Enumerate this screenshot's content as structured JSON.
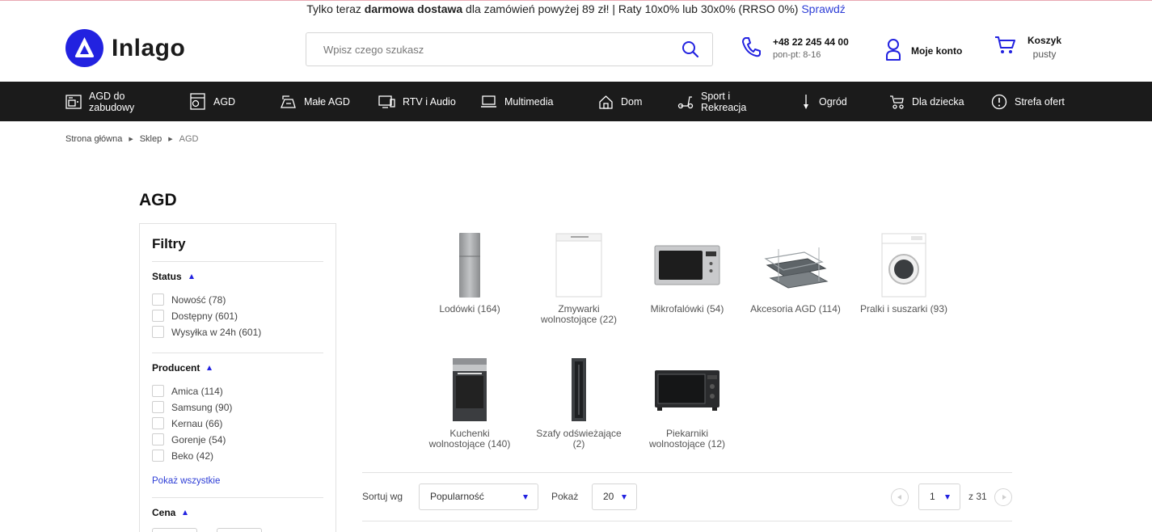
{
  "promo": {
    "before": "Tylko teraz ",
    "bold": "darmowa dostawa",
    "after": " dla zamówień powyżej 89 zł! | Raty 10x0% lub 30x0% (RRSO 0%) ",
    "link": "Sprawdź"
  },
  "brand": {
    "name": "Inlago",
    "color": "#2222e0"
  },
  "search": {
    "placeholder": "Wpisz czego szukasz"
  },
  "contact": {
    "phone": "+48 22 245 44 00",
    "hours": "pon-pt: 8-16"
  },
  "account": {
    "label": "Moje konto"
  },
  "cart": {
    "title": "Koszyk",
    "status": "pusty"
  },
  "nav": [
    {
      "label": "AGD do zabudowy",
      "icon": "built-in-appliance-icon"
    },
    {
      "label": "AGD",
      "icon": "fridge-icon"
    },
    {
      "label": "Małe AGD",
      "icon": "small-appliance-icon"
    },
    {
      "label": "RTV i Audio",
      "icon": "tv-icon"
    },
    {
      "label": "Multimedia",
      "icon": "laptop-icon"
    },
    {
      "label": "Dom",
      "icon": "home-icon"
    },
    {
      "label": "Sport i Rekreacja",
      "icon": "scooter-icon"
    },
    {
      "label": "Ogród",
      "icon": "garden-tool-icon"
    },
    {
      "label": "Dla dziecka",
      "icon": "stroller-icon"
    },
    {
      "label": "Strefa ofert",
      "icon": "offer-alert-icon"
    }
  ],
  "breadcrumb": {
    "home": "Strona główna",
    "shop": "Sklep",
    "current": "AGD"
  },
  "page_title": "AGD",
  "filters": {
    "title": "Filtry",
    "status": {
      "heading": "Status",
      "options": [
        "Nowość (78)",
        "Dostępny (601)",
        "Wysyłka w 24h (601)"
      ]
    },
    "producer": {
      "heading": "Producent",
      "options": [
        "Amica (114)",
        "Samsung (90)",
        "Kernau (66)",
        "Gorenje (54)",
        "Beko (42)"
      ],
      "show_all": "Pokaż wszystkie"
    },
    "price": {
      "heading": "Cena"
    }
  },
  "categories": [
    {
      "name": "Lodówki (164)",
      "icon": "fridge-image"
    },
    {
      "name": "Zmywarki wolnostojące (22)",
      "icon": "dishwasher-image"
    },
    {
      "name": "Mikrofalówki (54)",
      "icon": "microwave-image"
    },
    {
      "name": "Akcesoria AGD (114)",
      "icon": "oven-tray-image"
    },
    {
      "name": "Pralki i suszarki (93)",
      "icon": "washing-machine-image"
    },
    {
      "name": "Kuchenki wolnostojące (140)",
      "icon": "stove-image"
    },
    {
      "name": "Szafy odświeżające (2)",
      "icon": "refresh-cabinet-image"
    },
    {
      "name": "Piekarniki wolnostojące (12)",
      "icon": "mini-oven-image"
    }
  ],
  "sorting": {
    "sort_label": "Sortuj wg",
    "sort_value": "Popularność",
    "show_label": "Pokaż",
    "show_value": "20",
    "page_value": "1",
    "page_total": "z 31"
  }
}
